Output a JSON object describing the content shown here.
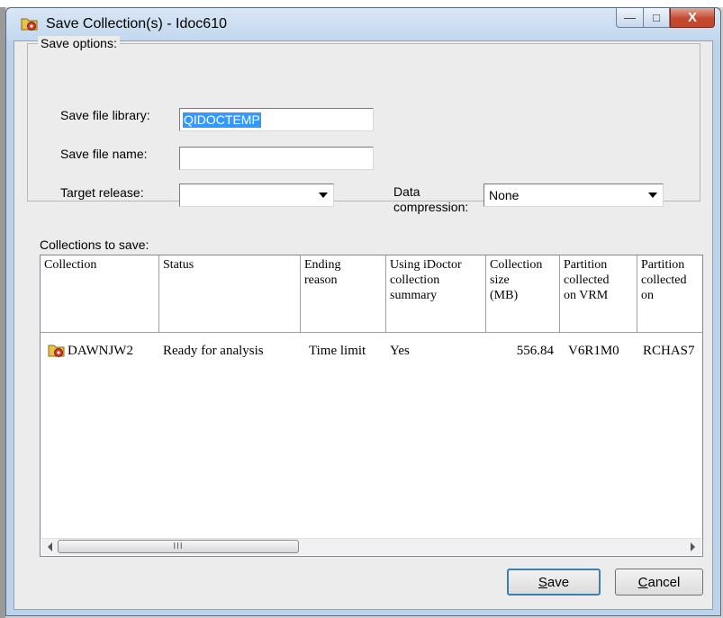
{
  "window": {
    "title": "Save Collection(s) - Idoc610",
    "minimize_glyph": "—",
    "maximize_glyph": "□",
    "close_glyph": "X"
  },
  "save_options": {
    "group_label": "Save options:",
    "library_label": "Save file library:",
    "library_value": "QIDOCTEMP",
    "name_label": "Save file name:",
    "name_value": "",
    "release_label": "Target release:",
    "release_value": "",
    "compression_label_1": "Data",
    "compression_label_2": "compression:",
    "compression_value": "None"
  },
  "collections": {
    "label": "Collections to save:",
    "columns": [
      "Collection",
      "Status",
      "Ending\nreason",
      "Using iDoctor\ncollection\nsummary",
      "Collection\nsize\n(MB)",
      "Partition\ncollected\non VRM",
      "Partition\ncollected\non"
    ],
    "rows": [
      {
        "collection": "DAWNJW2",
        "status": "Ready for analysis",
        "ending_reason": "Time limit",
        "using_summary": "Yes",
        "size_mb": "556.84",
        "vrm": "V6R1M0",
        "partition": "RCHAS7"
      }
    ],
    "scroll_thumb_grip": "III"
  },
  "buttons": {
    "save_mnemonic": "S",
    "save_rest": "ave",
    "cancel_mnemonic": "C",
    "cancel_rest": "ancel"
  },
  "colors": {
    "selection": "#3399ff",
    "close_button": "#c7452c",
    "titlebar": "#c2d7ee"
  }
}
